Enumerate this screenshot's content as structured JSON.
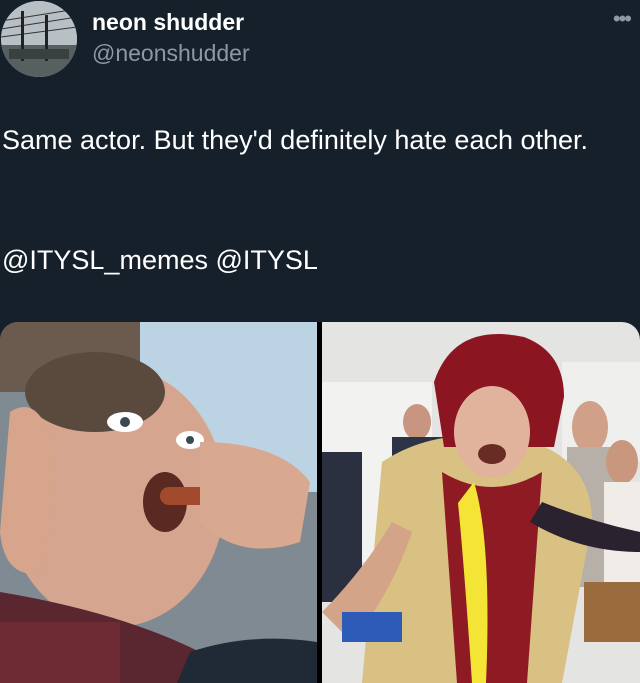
{
  "author": {
    "display_name": "neon shudder",
    "handle": "@neonshudder",
    "avatar_icon": "avatar-photo"
  },
  "more_icon": "ellipsis-icon",
  "more_glyph": "•••",
  "tweet": {
    "text": "Same actor. But they'd definitely hate each other.",
    "mentions": "@ITYSL_memes @ITYSL"
  },
  "colors": {
    "background": "#15202b",
    "primary_text": "#ffffff",
    "secondary_text": "#8b98a5"
  }
}
